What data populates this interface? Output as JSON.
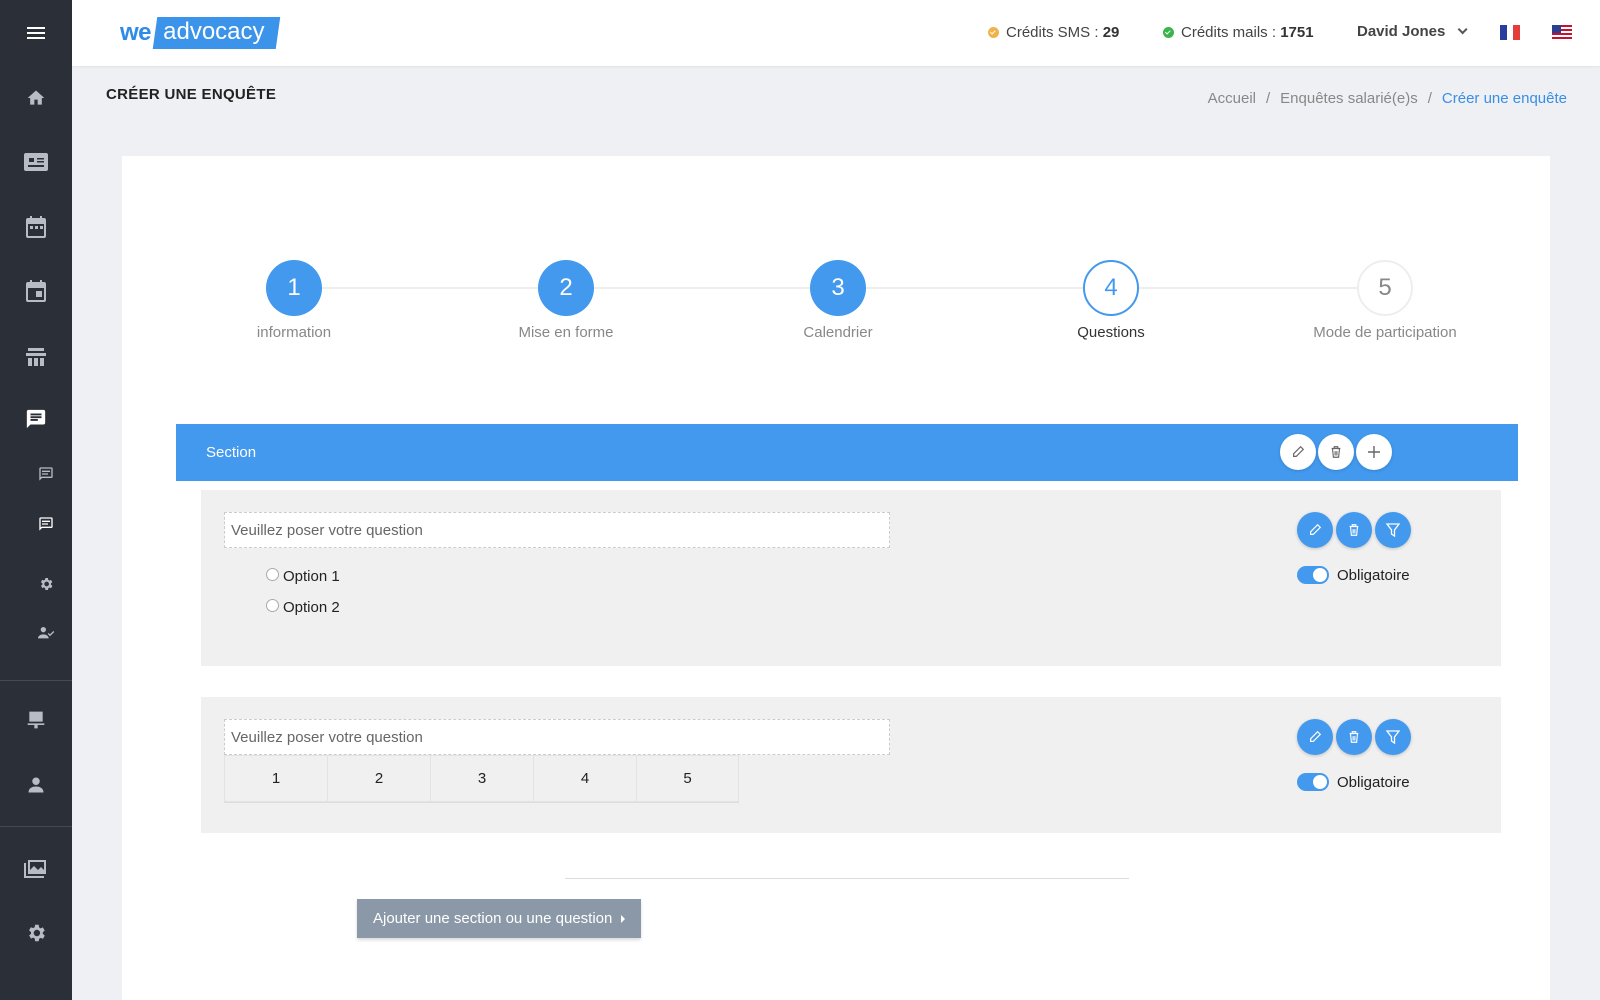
{
  "app": {
    "logo_we": "we",
    "logo_advocacy": "advocacy"
  },
  "header": {
    "sms_label": "Crédits SMS :",
    "sms_value": "29",
    "mails_label": "Crédits mails :",
    "mails_value": "1751",
    "user_name": "David Jones"
  },
  "page": {
    "title": "CRÉER UNE ENQUÊTE",
    "breadcrumb": [
      "Accueil",
      "Enquêtes salarié(e)s",
      "Créer une enquête"
    ]
  },
  "steps": [
    {
      "number": "1",
      "label": "information",
      "state": "done"
    },
    {
      "number": "2",
      "label": "Mise en forme",
      "state": "done"
    },
    {
      "number": "3",
      "label": "Calendrier",
      "state": "done"
    },
    {
      "number": "4",
      "label": "Questions",
      "state": "current"
    },
    {
      "number": "5",
      "label": "Mode de participation",
      "state": "future"
    }
  ],
  "section": {
    "title": "Section"
  },
  "questions": [
    {
      "placeholder": "Veuillez poser votre question",
      "type": "radio",
      "options": [
        "Option 1",
        "Option 2"
      ],
      "required_label": "Obligatoire",
      "required": true
    },
    {
      "placeholder": "Veuillez poser votre question",
      "type": "scale",
      "scale": [
        "1",
        "2",
        "3",
        "4",
        "5"
      ],
      "required_label": "Obligatoire",
      "required": true
    }
  ],
  "add_button_label": "Ajouter une section ou une question",
  "colors": {
    "accent": "#4299ee",
    "sidebar": "#2b2f37",
    "sms_status": "#f0b34a",
    "mail_status": "#3ab54a",
    "add_button": "#8a98a8"
  },
  "sidebar_icons": [
    "menu-icon",
    "home-icon",
    "contact-card-icon",
    "calendar-icon",
    "event-icon",
    "people-group-icon",
    "chat-icon",
    "message-icon",
    "message-icon",
    "gear-icon",
    "user-check-icon",
    "desktop-icon",
    "user-icon",
    "gallery-icon",
    "gear-icon"
  ]
}
